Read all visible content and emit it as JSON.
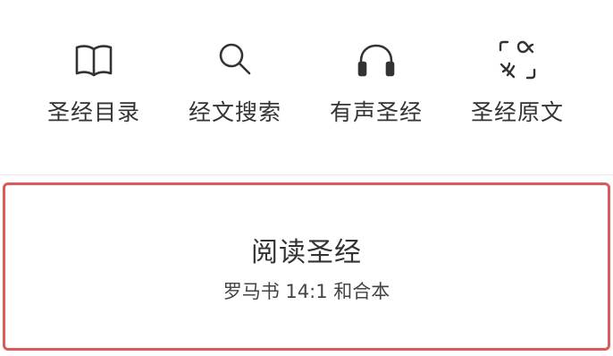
{
  "shortcuts": [
    {
      "label": "圣经目录",
      "icon": "book-icon"
    },
    {
      "label": "经文搜索",
      "icon": "search-icon"
    },
    {
      "label": "有声圣经",
      "icon": "headphones-icon"
    },
    {
      "label": "圣经原文",
      "icon": "original-language-icon"
    }
  ],
  "read_card": {
    "title": "阅读圣经",
    "subtitle": "罗马书 14:1 和合本",
    "border_color": "#db5a5a"
  },
  "colors": {
    "text": "#333333",
    "icon": "#333333",
    "accent_border": "#db5a5a"
  }
}
